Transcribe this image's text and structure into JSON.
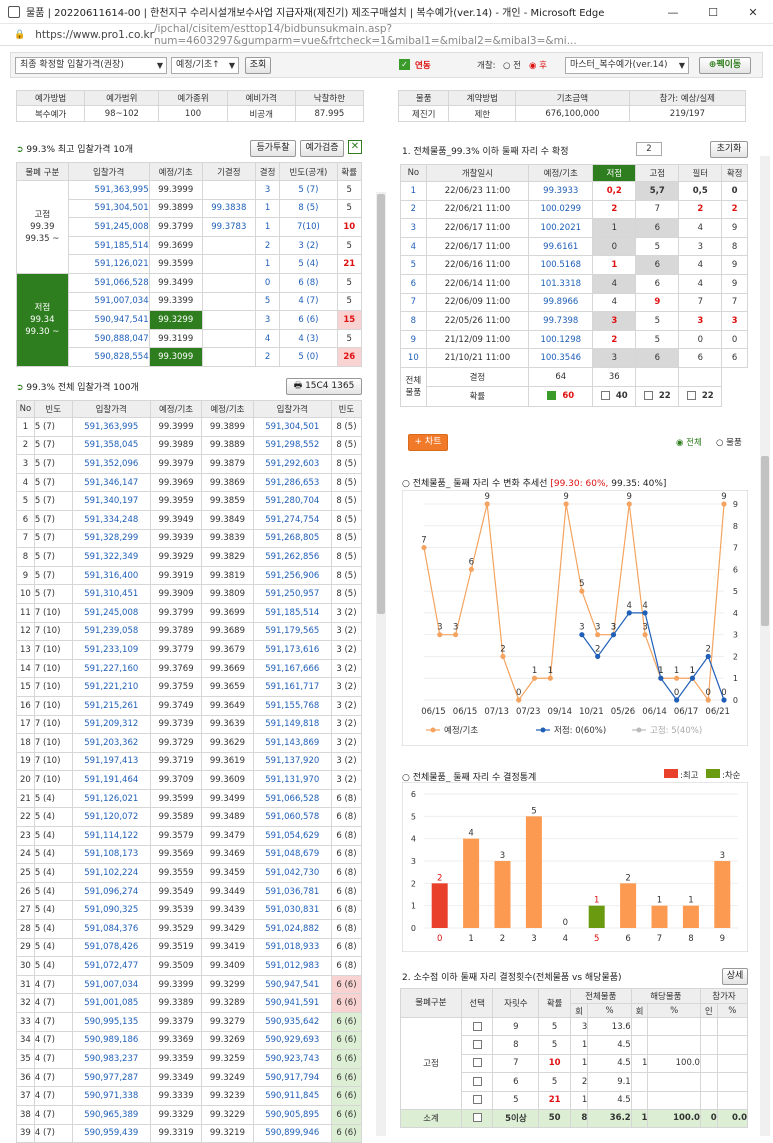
{
  "window": {
    "title": "물품 | 20220611614-00 | 한천지구 수리시설개보수사업 지급자재(제진기) 제조구매설치 | 복수예가(ver.14) - 개인 - Microsoft Edge"
  },
  "address": {
    "host": "https://www.pro1.co.kr",
    "path": "/ipchal/cisitem/esttop14/bidbunsukmain.asp?num=4603297&gumparm=vue&frtcheck=1&mibal1=&mibal2=&mibal3=&mi..."
  },
  "toolbar": {
    "mode_select": "최종 확정할 입찰가격(권장)",
    "base_select": "예정/기초↑",
    "search_btn": "조회",
    "linked_label": "연동",
    "open_label": "개찰:",
    "radio_before": "전",
    "radio_after": "후",
    "master_select": "마스터_복수예가(ver.14)",
    "move_btn": "펙이동"
  },
  "info_left": {
    "headers": [
      "예가방법",
      "예가범위",
      "예가종위",
      "예비가격",
      "낙찰하한"
    ],
    "values": [
      "복수예가",
      "98~102",
      "100",
      "비공개",
      "87.995"
    ]
  },
  "info_right": {
    "headers": [
      "물품",
      "계약방법",
      "기초금액",
      "참가: 예상/실제"
    ],
    "values": [
      "제진기",
      "제한",
      "676,100,000",
      "219/197"
    ]
  },
  "panel1": {
    "title": "99.3% 최고 입찰가격 10개",
    "btn1": "등가투찰",
    "btn2": "예가검증",
    "headers": [
      "물폐 구분",
      "입찰가격",
      "예정/기초",
      "기결정",
      "결정",
      "빈도(공개)",
      "확률"
    ],
    "groups": [
      {
        "label": "고점",
        "sub1": "99.39",
        "sub2": "99.35 ~"
      },
      {
        "label": "저점",
        "sub1": "99.34",
        "sub2": "99.30 ~"
      }
    ],
    "rows": [
      [
        "591,363,995",
        "99.3999",
        "",
        "3",
        "5 (7)",
        "5"
      ],
      [
        "591,304,501",
        "99.3899",
        "99.3838",
        "1",
        "8 (5)",
        "5"
      ],
      [
        "591,245,008",
        "99.3799",
        "99.3783",
        "1",
        "7(10)",
        "10"
      ],
      [
        "591,185,514",
        "99.3699",
        "",
        "2",
        "3 (2)",
        "5"
      ],
      [
        "591,126,021",
        "99.3599",
        "",
        "1",
        "5 (4)",
        "21"
      ],
      [
        "591,066,528",
        "99.3499",
        "",
        "0",
        "6 (8)",
        "5"
      ],
      [
        "591,007,034",
        "99.3399",
        "",
        "5",
        "4 (7)",
        "5"
      ],
      [
        "590,947,541",
        "99.3299",
        "",
        "3",
        "6 (6)",
        "15"
      ],
      [
        "590,888,047",
        "99.3199",
        "",
        "4",
        "4 (3)",
        "5"
      ],
      [
        "590,828,554",
        "99.3099",
        "",
        "2",
        "5 (0)",
        "26"
      ]
    ]
  },
  "panel2": {
    "title": "99.3% 전체 입찰가격 100개",
    "combo": "15C4 1365",
    "headers": [
      "No",
      "빈도",
      "입찰가격",
      "예정/기초",
      "예정/기초",
      "입찰가격",
      "빈도"
    ],
    "rows": [
      [
        "1",
        "5 (7)",
        "591,363,995",
        "99.3999",
        "99.3899",
        "591,304,501",
        "8 (5)"
      ],
      [
        "2",
        "5 (7)",
        "591,358,045",
        "99.3989",
        "99.3889",
        "591,298,552",
        "8 (5)"
      ],
      [
        "3",
        "5 (7)",
        "591,352,096",
        "99.3979",
        "99.3879",
        "591,292,603",
        "8 (5)"
      ],
      [
        "4",
        "5 (7)",
        "591,346,147",
        "99.3969",
        "99.3869",
        "591,286,653",
        "8 (5)"
      ],
      [
        "5",
        "5 (7)",
        "591,340,197",
        "99.3959",
        "99.3859",
        "591,280,704",
        "8 (5)"
      ],
      [
        "6",
        "5 (7)",
        "591,334,248",
        "99.3949",
        "99.3849",
        "591,274,754",
        "8 (5)"
      ],
      [
        "7",
        "5 (7)",
        "591,328,299",
        "99.3939",
        "99.3839",
        "591,268,805",
        "8 (5)"
      ],
      [
        "8",
        "5 (7)",
        "591,322,349",
        "99.3929",
        "99.3829",
        "591,262,856",
        "8 (5)"
      ],
      [
        "9",
        "5 (7)",
        "591,316,400",
        "99.3919",
        "99.3819",
        "591,256,906",
        "8 (5)"
      ],
      [
        "10",
        "5 (7)",
        "591,310,451",
        "99.3909",
        "99.3809",
        "591,250,957",
        "8 (5)"
      ],
      [
        "11",
        "7 (10)",
        "591,245,008",
        "99.3799",
        "99.3699",
        "591,185,514",
        "3 (2)"
      ],
      [
        "12",
        "7 (10)",
        "591,239,058",
        "99.3789",
        "99.3689",
        "591,179,565",
        "3 (2)"
      ],
      [
        "13",
        "7 (10)",
        "591,233,109",
        "99.3779",
        "99.3679",
        "591,173,616",
        "3 (2)"
      ],
      [
        "14",
        "7 (10)",
        "591,227,160",
        "99.3769",
        "99.3669",
        "591,167,666",
        "3 (2)"
      ],
      [
        "15",
        "7 (10)",
        "591,221,210",
        "99.3759",
        "99.3659",
        "591,161,717",
        "3 (2)"
      ],
      [
        "16",
        "7 (10)",
        "591,215,261",
        "99.3749",
        "99.3649",
        "591,155,768",
        "3 (2)"
      ],
      [
        "17",
        "7 (10)",
        "591,209,312",
        "99.3739",
        "99.3639",
        "591,149,818",
        "3 (2)"
      ],
      [
        "18",
        "7 (10)",
        "591,203,362",
        "99.3729",
        "99.3629",
        "591,143,869",
        "3 (2)"
      ],
      [
        "19",
        "7 (10)",
        "591,197,413",
        "99.3719",
        "99.3619",
        "591,137,920",
        "3 (2)"
      ],
      [
        "20",
        "7 (10)",
        "591,191,464",
        "99.3709",
        "99.3609",
        "591,131,970",
        "3 (2)"
      ],
      [
        "21",
        "5 (4)",
        "591,126,021",
        "99.3599",
        "99.3499",
        "591,066,528",
        "6 (8)"
      ],
      [
        "22",
        "5 (4)",
        "591,120,072",
        "99.3589",
        "99.3489",
        "591,060,578",
        "6 (8)"
      ],
      [
        "23",
        "5 (4)",
        "591,114,122",
        "99.3579",
        "99.3479",
        "591,054,629",
        "6 (8)"
      ],
      [
        "24",
        "5 (4)",
        "591,108,173",
        "99.3569",
        "99.3469",
        "591,048,679",
        "6 (8)"
      ],
      [
        "25",
        "5 (4)",
        "591,102,224",
        "99.3559",
        "99.3459",
        "591,042,730",
        "6 (8)"
      ],
      [
        "26",
        "5 (4)",
        "591,096,274",
        "99.3549",
        "99.3449",
        "591,036,781",
        "6 (8)"
      ],
      [
        "27",
        "5 (4)",
        "591,090,325",
        "99.3539",
        "99.3439",
        "591,030,831",
        "6 (8)"
      ],
      [
        "28",
        "5 (4)",
        "591,084,376",
        "99.3529",
        "99.3429",
        "591,024,882",
        "6 (8)"
      ],
      [
        "29",
        "5 (4)",
        "591,078,426",
        "99.3519",
        "99.3419",
        "591,018,933",
        "6 (8)"
      ],
      [
        "30",
        "5 (4)",
        "591,072,477",
        "99.3509",
        "99.3409",
        "591,012,983",
        "6 (8)"
      ],
      [
        "31",
        "4 (7)",
        "591,007,034",
        "99.3399",
        "99.3299",
        "590,947,541",
        "6 (6)"
      ],
      [
        "32",
        "4 (7)",
        "591,001,085",
        "99.3389",
        "99.3289",
        "590,941,591",
        "6 (6)"
      ],
      [
        "33",
        "4 (7)",
        "590,995,135",
        "99.3379",
        "99.3279",
        "590,935,642",
        "6 (6)"
      ],
      [
        "34",
        "4 (7)",
        "590,989,186",
        "99.3369",
        "99.3269",
        "590,929,693",
        "6 (6)"
      ],
      [
        "35",
        "4 (7)",
        "590,983,237",
        "99.3359",
        "99.3259",
        "590,923,743",
        "6 (6)"
      ],
      [
        "36",
        "4 (7)",
        "590,977,287",
        "99.3349",
        "99.3249",
        "590,917,794",
        "6 (6)"
      ],
      [
        "37",
        "4 (7)",
        "590,971,338",
        "99.3339",
        "99.3239",
        "590,911,845",
        "6 (6)"
      ],
      [
        "38",
        "4 (7)",
        "590,965,389",
        "99.3329",
        "99.3229",
        "590,905,895",
        "6 (6)"
      ],
      [
        "39",
        "4 (7)",
        "590,959,439",
        "99.3319",
        "99.3219",
        "590,899,946",
        "6 (6)"
      ]
    ]
  },
  "panel3": {
    "title": "1. 전체물품_99.3% 이하 둘째 자리 수 확정",
    "input_value": "2",
    "reset_btn": "초기화",
    "headers": [
      "No",
      "개찰일시",
      "예정/기초",
      "저점",
      "고점",
      "필터",
      "확정"
    ],
    "rows": [
      [
        "1",
        "22/06/23 11:00",
        "99.3933",
        "0,2",
        "5,7",
        "0,5",
        "0"
      ],
      [
        "2",
        "22/06/21 11:00",
        "100.0299",
        "2",
        "7",
        "2",
        "2"
      ],
      [
        "3",
        "22/06/17 11:00",
        "100.2021",
        "1",
        "6",
        "4",
        "9"
      ],
      [
        "4",
        "22/06/17 11:00",
        "99.6161",
        "0",
        "5",
        "3",
        "8"
      ],
      [
        "5",
        "22/06/16 11:00",
        "100.5168",
        "1",
        "6",
        "4",
        "9"
      ],
      [
        "6",
        "22/06/14 11:00",
        "101.3318",
        "4",
        "6",
        "4",
        "9"
      ],
      [
        "7",
        "22/06/09 11:00",
        "99.8966",
        "4",
        "9",
        "7",
        "7"
      ],
      [
        "8",
        "22/05/26 11:00",
        "99.7398",
        "3",
        "5",
        "3",
        "3"
      ],
      [
        "9",
        "21/12/09 11:00",
        "100.1298",
        "2",
        "5",
        "0",
        "0"
      ],
      [
        "10",
        "21/10/21 11:00",
        "100.3546",
        "3",
        "6",
        "6",
        "6"
      ]
    ],
    "summary_label": "전체\n물품",
    "decided_label": "결정",
    "decided_low": "64",
    "decided_high": "36",
    "prob_label": "확률",
    "prob_low": "60",
    "prob_high": "40",
    "prob_filter": "22",
    "prob_confirm": "22"
  },
  "chart_controls": {
    "chart_btn": "+ 차트",
    "radio_all": "전체",
    "radio_item": "물품"
  },
  "chart1_title": "전체물품_ 둘째 자리 수 변화 추세선",
  "chart1_note1": "[99.30: 60%,",
  "chart1_note2": "99.35: 40%]",
  "chart2_title": "전체물품_ 둘째 자리 수 결정통계",
  "chart2_leg1": ":최고",
  "chart2_leg2": ":차순",
  "panel4": {
    "title": "2. 소수점 이하 둘째 자리 결정횟수(전체물품 vs 해당물품)",
    "btn": "상세",
    "h1": [
      "물폐구분",
      "선택",
      "자릿수",
      "확률",
      "전체물품",
      "해당물품",
      "참가자"
    ],
    "h2": [
      "회",
      "%",
      "회",
      "%",
      "인",
      "%"
    ],
    "group": "고점",
    "rows": [
      [
        "9",
        "5",
        "3",
        "13.6",
        "",
        "",
        "",
        ""
      ],
      [
        "8",
        "5",
        "1",
        "4.5",
        "",
        "",
        "",
        ""
      ],
      [
        "7",
        "10",
        "1",
        "4.5",
        "1",
        "100.0",
        "",
        ""
      ],
      [
        "6",
        "5",
        "2",
        "9.1",
        "",
        "",
        "",
        ""
      ],
      [
        "5",
        "21",
        "1",
        "4.5",
        "",
        "",
        "",
        ""
      ]
    ],
    "subtotal": [
      "소계",
      "5이상",
      "50",
      "8",
      "36.2",
      "1",
      "100.0",
      "0",
      "0.0"
    ]
  },
  "chart_data": [
    {
      "type": "line",
      "title": "전체물품_ 둘째 자리 수 변화 추세선",
      "categories": [
        "06/15",
        "06/15",
        "07/13",
        "07/23",
        "09/14",
        "10/21",
        "05/26",
        "06/14",
        "06/17",
        "06/21"
      ],
      "x": [
        "06/15",
        "06/15",
        "06/15",
        "07/13",
        "07/13",
        "07/23",
        "07/23",
        "09/14",
        "09/14",
        "10/21",
        "10/21",
        "05/26",
        "05/26",
        "06/14",
        "06/14",
        "06/17",
        "06/17",
        "06/21",
        "06/21",
        "06/21"
      ],
      "series": [
        {
          "name": "예정/기초",
          "color": "#f4a460",
          "values": [
            7,
            3,
            3,
            6,
            9,
            2,
            0,
            1,
            1,
            9,
            5,
            3,
            3,
            9,
            3,
            1,
            1,
            1,
            0,
            9
          ]
        },
        {
          "name": "저점: 0(60%)",
          "color": "#1f5fb8",
          "values": [
            null,
            null,
            null,
            null,
            null,
            null,
            null,
            null,
            null,
            null,
            3,
            2,
            3,
            4,
            4,
            1,
            0,
            1,
            2,
            0
          ]
        },
        {
          "name": "고점: 5(40%)",
          "color": "#bbb",
          "values": []
        }
      ],
      "ylim": [
        0,
        9
      ]
    },
    {
      "type": "bar",
      "title": "전체물품_ 둘째 자리 수 결정통계",
      "categories": [
        "0",
        "1",
        "2",
        "3",
        "4",
        "5",
        "6",
        "7",
        "8",
        "9"
      ],
      "values": [
        2,
        4,
        3,
        5,
        0,
        1,
        2,
        1,
        1,
        3
      ],
      "colors": [
        "#e8402a",
        "#fb9a50",
        "#fb9a50",
        "#fb9a50",
        "#fb9a50",
        "#6a9a10",
        "#fb9a50",
        "#fb9a50",
        "#fb9a50",
        "#fb9a50"
      ],
      "ylim": [
        0,
        6
      ],
      "legend": [
        "최고",
        "차순"
      ]
    }
  ]
}
